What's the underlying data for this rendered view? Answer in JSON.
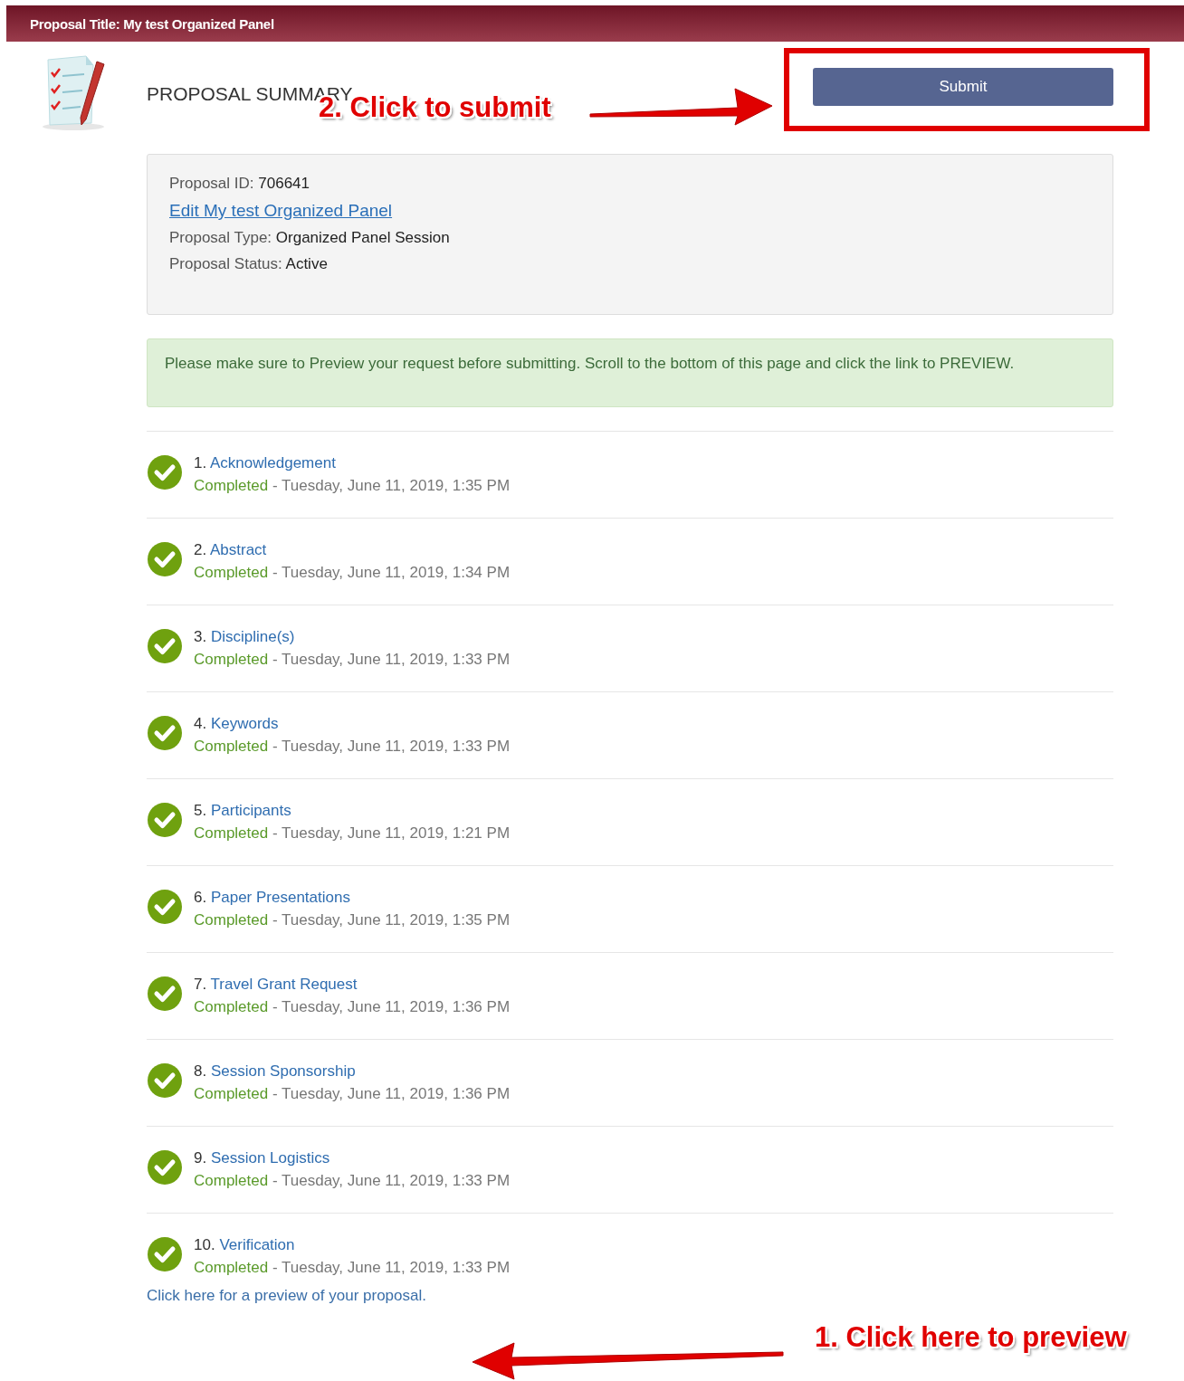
{
  "header": {
    "title": "Proposal Title: My test Organized Panel"
  },
  "summary": {
    "heading": "PROPOSAL SUMMARY",
    "submit": "Submit"
  },
  "info": {
    "rows": [
      {
        "label": "Proposal ID:",
        "value": "706641",
        "kind": "text"
      },
      {
        "value": "Edit My test Organized Panel",
        "kind": "link"
      },
      {
        "label": "Proposal Type:",
        "value": "Organized Panel Session",
        "kind": "text"
      },
      {
        "label": "Proposal Status:",
        "value": "Active",
        "kind": "text"
      }
    ]
  },
  "alert": "Please make sure to Preview your request before submitting. Scroll to the bottom of this page and click the link to PREVIEW.",
  "steps": [
    {
      "number": "1.",
      "title": "Acknowledgement",
      "status": "Completed",
      "date": "- Tuesday, June 11, 2019, 1:35 PM",
      "completed": true
    },
    {
      "number": "2.",
      "title": "Abstract",
      "status": "Completed",
      "date": "- Tuesday, June 11, 2019, 1:34 PM",
      "completed": true
    },
    {
      "number": "3.",
      "title": "Discipline(s)",
      "status": "Completed",
      "date": "- Tuesday, June 11, 2019, 1:33 PM",
      "completed": true
    },
    {
      "number": "4.",
      "title": "Keywords",
      "status": "Completed",
      "date": "- Tuesday, June 11, 2019, 1:33 PM",
      "completed": true
    },
    {
      "number": "5.",
      "title": "Participants",
      "status": "Completed",
      "date": "- Tuesday, June 11, 2019, 1:21 PM",
      "completed": true
    },
    {
      "number": "6.",
      "title": "Paper Presentations",
      "status": "Completed",
      "date": "- Tuesday, June 11, 2019, 1:35 PM",
      "completed": true
    },
    {
      "number": "7.",
      "title": "Travel Grant Request",
      "status": "Completed",
      "date": "- Tuesday, June 11, 2019, 1:36 PM",
      "completed": true
    },
    {
      "number": "8.",
      "title": "Session Sponsorship",
      "status": "Completed",
      "date": "- Tuesday, June 11, 2019, 1:36 PM",
      "completed": true
    },
    {
      "number": "9.",
      "title": "Session Logistics",
      "status": "Completed",
      "date": "- Tuesday, June 11, 2019, 1:33 PM",
      "completed": true
    },
    {
      "number": "10.",
      "title": "Verification",
      "status": "Completed",
      "date": "- Tuesday, June 11, 2019, 1:33 PM",
      "completed": true
    }
  ],
  "preview_link": "Click here for a preview of your proposal.",
  "annotations": [
    {
      "text": "2. Click to submit",
      "kind": "submit"
    },
    {
      "text": "1. Click here to preview",
      "kind": "preview"
    }
  ]
}
